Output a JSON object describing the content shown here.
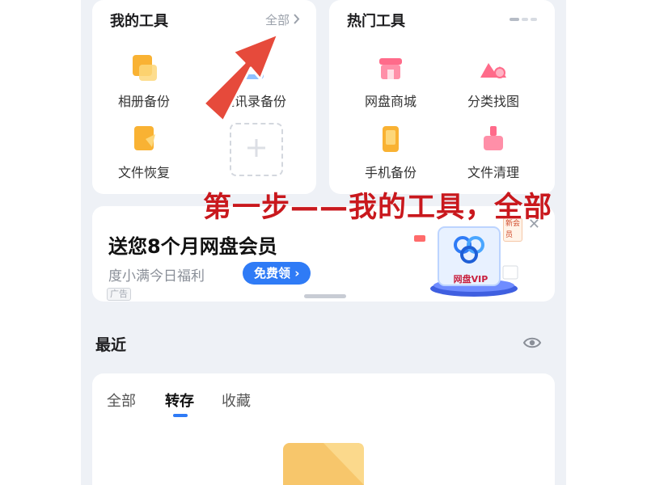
{
  "my_tools": {
    "title": "我的工具",
    "all_link": "全部",
    "items": [
      {
        "label": "相册备份",
        "icon": "photo-album-icon"
      },
      {
        "label": "通讯录备份",
        "icon": "contacts-icon"
      },
      {
        "label": "文件恢复",
        "icon": "file-restore-icon"
      }
    ],
    "add_icon": "plus-icon"
  },
  "hot_tools": {
    "title": "热门工具",
    "items": [
      {
        "label": "网盘商城",
        "icon": "store-icon"
      },
      {
        "label": "分类找图",
        "icon": "image-search-icon"
      },
      {
        "label": "手机备份",
        "icon": "phone-backup-icon"
      },
      {
        "label": "文件清理",
        "icon": "file-clean-icon"
      }
    ]
  },
  "annotation": "第一步——我的工具，全部",
  "ad": {
    "title": "送您8个月网盘会员",
    "subtitle": "度小满今日福利",
    "button": "免费领",
    "tag": "广告",
    "badge_text": "网盘VIP",
    "corner_label": "新会员"
  },
  "recent": {
    "title": "最近",
    "tabs": [
      {
        "label": "全部",
        "active": false
      },
      {
        "label": "转存",
        "active": true
      },
      {
        "label": "收藏",
        "active": false
      }
    ]
  },
  "colors": {
    "accent": "#2f7bf6",
    "annotation": "#c9181d",
    "arrow": "#e64a3b",
    "background": "#eef1f6"
  }
}
